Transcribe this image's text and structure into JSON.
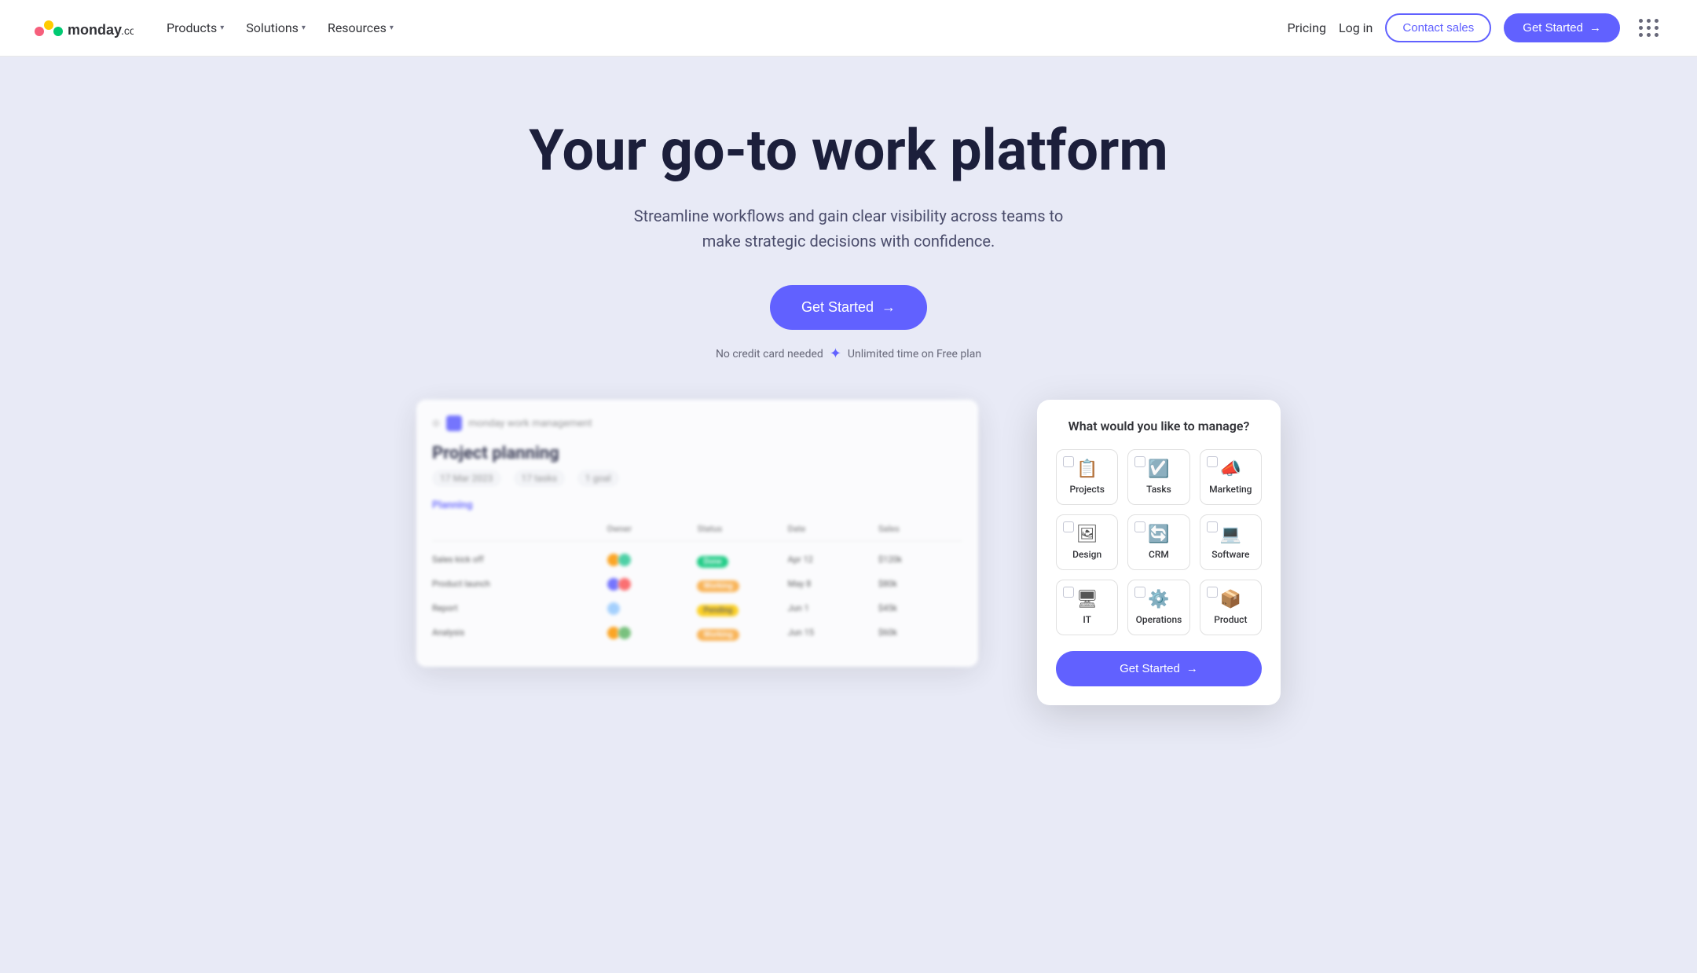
{
  "nav": {
    "logo_text": "monday.com",
    "links": [
      {
        "label": "Products",
        "has_dropdown": true
      },
      {
        "label": "Solutions",
        "has_dropdown": true
      },
      {
        "label": "Resources",
        "has_dropdown": true
      }
    ],
    "right_links": [
      {
        "label": "Pricing",
        "type": "text"
      },
      {
        "label": "Log in",
        "type": "text"
      }
    ],
    "contact_label": "Contact sales",
    "get_started_label": "Get Started"
  },
  "hero": {
    "title": "Your go-to work platform",
    "subtitle": "Streamline workflows and gain clear visibility across teams to make strategic decisions with confidence.",
    "cta_label": "Get Started",
    "note_text": "No credit card needed",
    "note_separator": "✦",
    "note_text2": "Unlimited time on Free plan"
  },
  "dashboard": {
    "title": "monday work management",
    "project_title": "Project planning",
    "meta": [
      "17 Mar 2023",
      "17 tasks",
      "1 goal"
    ],
    "section_label": "Planning",
    "columns": [
      "",
      "Owner",
      "Status",
      "Date",
      "Sales"
    ],
    "rows": [
      {
        "name": "Sales kick off",
        "status": "green",
        "status_label": "Done"
      },
      {
        "name": "Product launch",
        "status": "orange",
        "status_label": "Working"
      },
      {
        "name": "Report",
        "status": "yellow",
        "status_label": "Pending"
      },
      {
        "name": "Analysis",
        "status": "orange",
        "status_label": "Working"
      }
    ]
  },
  "manage_card": {
    "title": "What would you like to manage?",
    "items": [
      {
        "label": "Projects",
        "icon": "📋"
      },
      {
        "label": "Tasks",
        "icon": "✅"
      },
      {
        "label": "Marketing",
        "icon": "📣"
      },
      {
        "label": "Design",
        "icon": "🎨"
      },
      {
        "label": "CRM",
        "icon": "🔄"
      },
      {
        "label": "Software",
        "icon": "💻"
      },
      {
        "label": "IT",
        "icon": "🖥"
      },
      {
        "label": "Operations",
        "icon": "⚙️"
      },
      {
        "label": "Product",
        "icon": "📦"
      }
    ],
    "cta_label": "Get Started"
  },
  "colors": {
    "accent": "#6161ff",
    "hero_bg": "#e8eaf6"
  }
}
